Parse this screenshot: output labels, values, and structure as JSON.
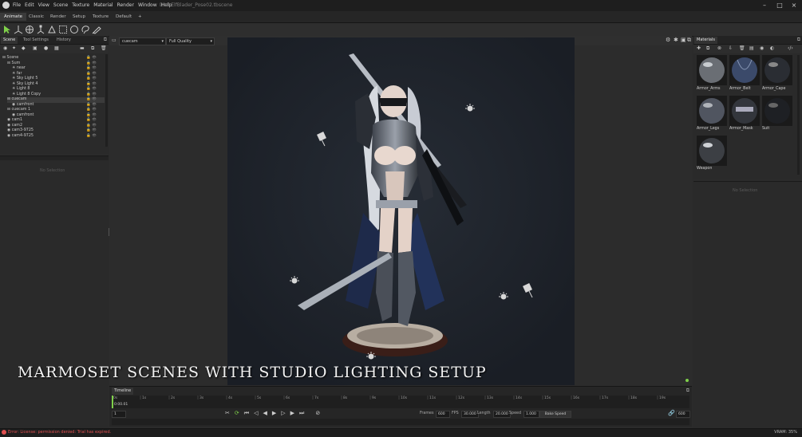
{
  "menubar": {
    "items": [
      "File",
      "Edit",
      "View",
      "Scene",
      "Texture",
      "Material",
      "Render",
      "Window",
      "Help"
    ],
    "filename": "DarkElfBlader_Pose02.tbscene"
  },
  "workspace_tabs": [
    "Animate",
    "Classic",
    "Render",
    "Setup",
    "Texture",
    "Default",
    "+"
  ],
  "left_panel": {
    "tabs": [
      "Scene",
      "Tool Settings",
      "History"
    ],
    "tree": [
      "Scene",
      "Sum",
      "near",
      "far",
      "Sky Light 5",
      "Sky Light 4",
      "Light 8",
      "Light 8 Copy",
      "cuecam",
      "camfront",
      "cuecam 1",
      "camfront",
      "cam1",
      "cam2",
      "cam3-9725",
      "cam4-9725"
    ],
    "properties_empty": "No Selection"
  },
  "viewport": {
    "camera_select": "cuecam",
    "quality_select": "Full Quality"
  },
  "caption": "MARMOSET SCENES WITH STUDIO LIGHTING SETUP",
  "timeline": {
    "title": "Timeline",
    "ticks": [
      "0s",
      "1s",
      "2s",
      "3s",
      "4s",
      "5s",
      "6s",
      "7s",
      "8s",
      "9s",
      "10s",
      "11s",
      "12s",
      "13s",
      "14s",
      "15s",
      "16s",
      "17s",
      "18s",
      "19s"
    ],
    "current_time": "0:00.01",
    "frame_field": "1",
    "frames_label": "Frames",
    "frames_value": "600",
    "fps_label": "FPS",
    "fps_value": "30.000",
    "length_label": "Length",
    "length_value": "20.000",
    "speed_label": "Speed",
    "speed_value": "1.000",
    "bake_label": "Bake Speed",
    "end_value": "600"
  },
  "materials": {
    "title": "Materials",
    "items": [
      "Armor_Arms",
      "Armor_Belt",
      "Armor_Cape",
      "Armor_Legs",
      "Armor_Mask",
      "Suit",
      "Weapon"
    ],
    "properties_empty": "No Selection"
  },
  "status": {
    "error": "Error: License: permission denied: Trial has expired.",
    "vram": "VRAM: 35%"
  },
  "colors": {
    "accent_green": "#7fd04a",
    "error_red": "#e05050",
    "viewport_bg": "#1c2128"
  }
}
